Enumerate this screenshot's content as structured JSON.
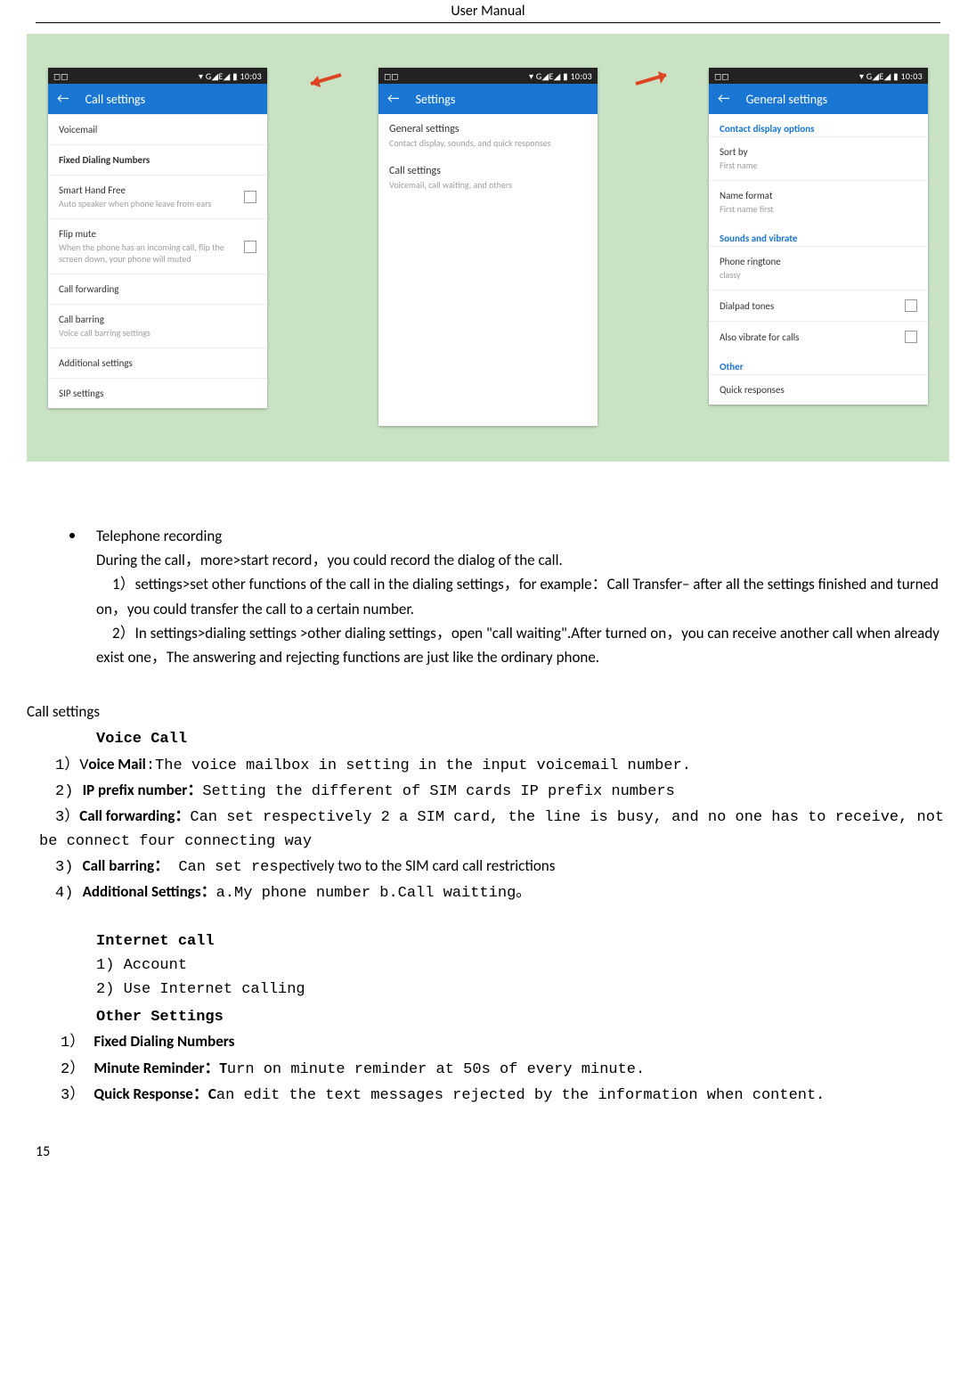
{
  "header": {
    "title": "User    Manual"
  },
  "status": {
    "left_icons": "◻◻",
    "right": "▾ G◢E◢ ▮ 10:03"
  },
  "phones": {
    "p1": {
      "title": "Call settings",
      "r1": "Voicemail",
      "r2": "Fixed Dialing Numbers",
      "r3t": "Smart Hand Free",
      "r3s": "Auto speaker when phone leave from ears",
      "r4t": "Flip mute",
      "r4s": "When the phone has an incoming call, flip the screen down, your phone will muted",
      "r5": "Call forwarding",
      "r6t": "Call barring",
      "r6s": "Voice call barring settings",
      "r7": "Additional settings",
      "r8": "SIP settings"
    },
    "p2": {
      "title": "Settings",
      "g1t": "General settings",
      "g1s": "Contact display, sounds, and quick responses",
      "g2t": "Call settings",
      "g2s": "Voicemail, call waiting, and others"
    },
    "p3": {
      "title": "General settings",
      "s1": "Contact display options",
      "r1t": "Sort by",
      "r1s": "First name",
      "r2t": "Name format",
      "r2s": "First name first",
      "s2": "Sounds and vibrate",
      "r3t": "Phone ringtone",
      "r3s": "classy",
      "r4": "Dialpad tones",
      "r5": "Also vibrate for calls",
      "s3": "Other",
      "r6": "Quick responses"
    }
  },
  "text": {
    "bullet": "Telephone recording",
    "l1": "During the call，more>start record，you could record the dialog of the call.",
    "l2": "1）settings>set other functions of the call in the dialing settings，for example：Call Transfer– after all the settings finished and turned on，you could transfer the call to a certain number.",
    "l3": "2）In settings>dialing settings >other dialing settings，open  \"call waiting\".After turned on，you can receive another call when already exist one，The answering and rejecting functions are just like the ordinary phone.",
    "h1": "Call settings",
    "h2": "Voice Call",
    "vc1a": "1）V",
    "vc1b": "oice Mail",
    "vc1c": ":The voice mailbox in setting in the input voicemail number.",
    "vc2a": "2) ",
    "vc2b": "IP prefix number：",
    "vc2c": "Setting the different of SIM cards IP prefix numbers",
    "vc3a": "3）",
    "vc3b": "Call forwarding：",
    "vc3c": "Can set respectively 2 a SIM card, the line is busy, and no one has to receive, not be connect four connecting way",
    "vc4a": "3) ",
    "vc4b": "Call barring：",
    "vc4c": " Can set resp",
    "vc4d": "ectively two to the SIM card call restrictions",
    "vc5a": "4) ",
    "vc5b": "Additional Settings：",
    "vc5c": "a.My phone number b.Call waitting。",
    "h3": "Internet call",
    "ic1": "1)  Account",
    "ic2": "2)  Use Internet calling",
    "h4": "Other Settings",
    "os1a": "1） ",
    "os1b": "Fixed Dialing Numbers",
    "os2a": "2） ",
    "os2b": "Minute Reminder：T",
    "os2c": "urn on minute reminder at 50s of every minute.",
    "os3a": "3） ",
    "os3b": "Quick Response：C",
    "os3c": "an edit the text messages rejected by the information when content."
  },
  "footer": {
    "page": "15"
  }
}
